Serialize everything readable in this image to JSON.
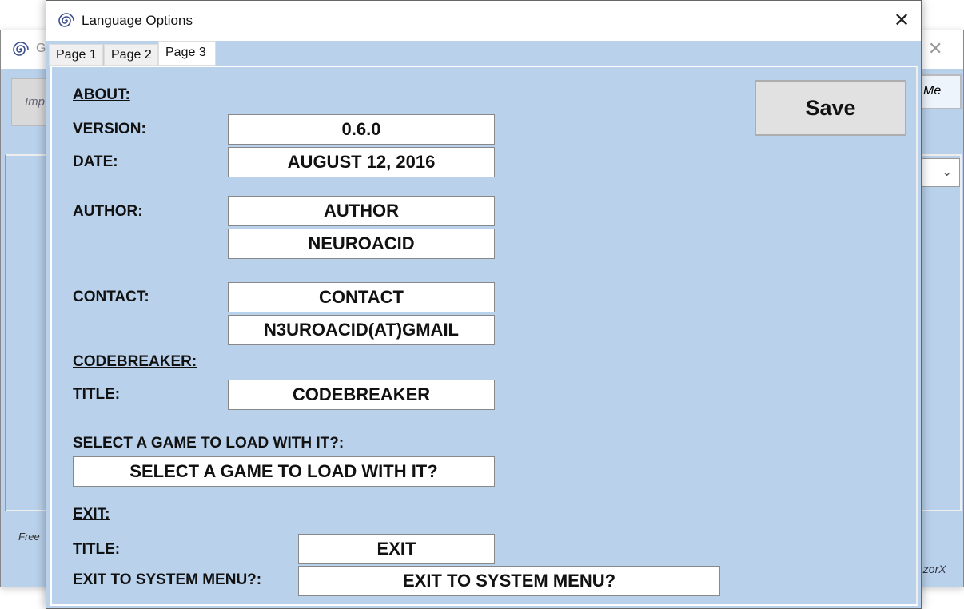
{
  "background_window": {
    "title_partial": "G",
    "button_left_partial": "Imp",
    "button_right_partial": "Me",
    "footer_left_partial": "Free",
    "footer_right_partial": "azorX"
  },
  "window": {
    "title": "Language Options",
    "close_glyph": "✕"
  },
  "tabs": [
    {
      "label": "Page 1",
      "active": false
    },
    {
      "label": "Page 2",
      "active": false
    },
    {
      "label": "Page 3",
      "active": true
    }
  ],
  "save_label": "Save",
  "about": {
    "heading": "ABOUT:",
    "version_label": "VERSION:",
    "version_value": "0.6.0",
    "date_label": "DATE:",
    "date_value": "AUGUST 12, 2016",
    "author_label": "AUTHOR:",
    "author_value": "AUTHOR",
    "author_name_value": "NEUROACID",
    "contact_label": "CONTACT:",
    "contact_value": "CONTACT",
    "contact_email_value": "N3UROACID(AT)GMAIL"
  },
  "codebreaker": {
    "heading": "CODEBREAKER:",
    "title_label": "TITLE:",
    "title_value": "CODEBREAKER",
    "select_label": "SELECT A GAME TO LOAD WITH IT?:",
    "select_value": "SELECT A GAME TO LOAD WITH IT?"
  },
  "exit": {
    "heading": "EXIT:",
    "title_label": "TITLE:",
    "title_value": "EXIT",
    "system_label": "EXIT TO SYSTEM MENU?:",
    "system_value": "EXIT TO SYSTEM MENU?"
  }
}
